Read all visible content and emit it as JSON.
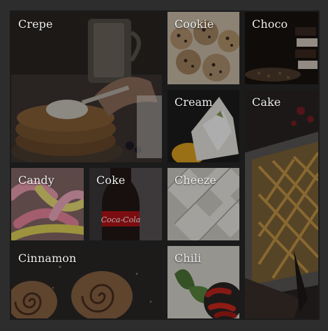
{
  "gallery": {
    "tiles": [
      {
        "label": "Crepe"
      },
      {
        "label": "Cookie"
      },
      {
        "label": "Choco"
      },
      {
        "label": "Cream"
      },
      {
        "label": "Cake"
      },
      {
        "label": "Candy"
      },
      {
        "label": "Coke"
      },
      {
        "label": "Cheeze"
      },
      {
        "label": "Cinnamon"
      },
      {
        "label": "Chili"
      }
    ],
    "coke_logo_text": "Coca-Cola"
  }
}
